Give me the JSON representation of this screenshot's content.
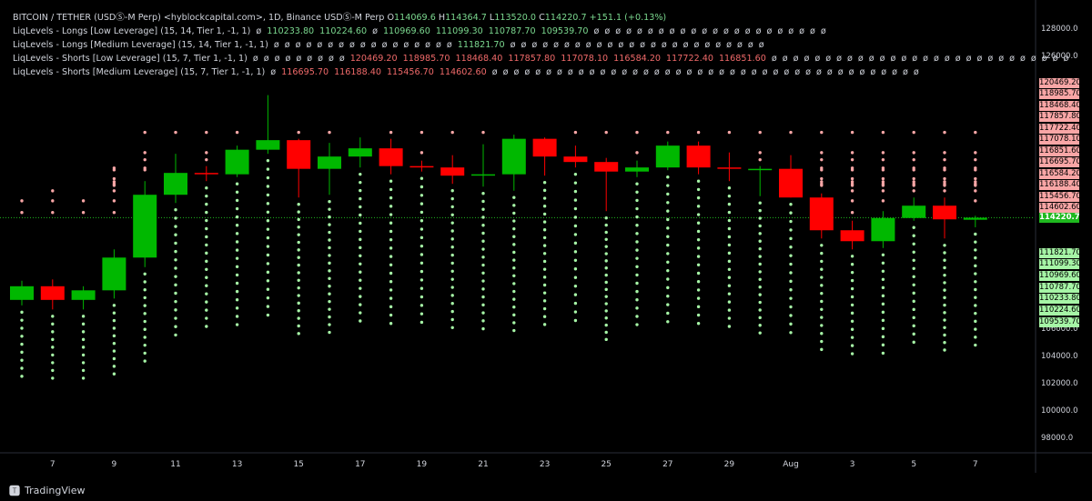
{
  "header": {
    "title": "BITCOIN / TETHER (USDⓈ-M Perp) <hyblockcapital.com>, 1D, Binance USDⓈ-M Perp",
    "ohlc": [
      {
        "label": "O",
        "value": "114069.6"
      },
      {
        "label": "H",
        "value": "114364.7"
      },
      {
        "label": "L",
        "value": "113520.0"
      },
      {
        "label": "C",
        "value": "114220.7"
      }
    ],
    "change": "+151.1 (+0.13%)"
  },
  "indicators": [
    {
      "name": "LiqLevels - Longs [Low Leverage] (15, 14, Tier 1, -1, 1)",
      "values": [
        "ø",
        "110233.80",
        "110224.60",
        "ø",
        "110969.60",
        "111099.30",
        "110787.70",
        "109539.70",
        "ø",
        "ø",
        "ø",
        "ø",
        "ø",
        "ø",
        "ø",
        "ø",
        "ø",
        "ø",
        "ø",
        "ø",
        "ø",
        "ø",
        "ø",
        "ø",
        "ø",
        "ø",
        "ø",
        "ø",
        "ø",
        "ø"
      ],
      "color": "#7bd88f"
    },
    {
      "name": "LiqLevels - Longs [Medium Leverage] (15, 14, Tier 1, -1, 1)",
      "values": [
        "ø",
        "ø",
        "ø",
        "ø",
        "ø",
        "ø",
        "ø",
        "ø",
        "ø",
        "ø",
        "ø",
        "ø",
        "ø",
        "ø",
        "ø",
        "ø",
        "ø",
        "111821.70",
        "ø",
        "ø",
        "ø",
        "ø",
        "ø",
        "ø",
        "ø",
        "ø",
        "ø",
        "ø",
        "ø",
        "ø",
        "ø",
        "ø",
        "ø",
        "ø",
        "ø",
        "ø",
        "ø",
        "ø",
        "ø",
        "ø",
        "ø",
        "ø"
      ],
      "color": "#7bd88f"
    },
    {
      "name": "LiqLevels - Shorts [Low Leverage] (15, 7, Tier 1, -1, 1)",
      "values": [
        "ø",
        "ø",
        "ø",
        "ø",
        "ø",
        "ø",
        "ø",
        "ø",
        "ø",
        "120469.20",
        "118985.70",
        "118468.40",
        "117857.80",
        "117078.10",
        "116584.20",
        "117722.40",
        "116851.60",
        "ø",
        "ø",
        "ø",
        "ø",
        "ø",
        "ø",
        "ø",
        "ø",
        "ø",
        "ø",
        "ø",
        "ø",
        "ø",
        "ø",
        "ø",
        "ø",
        "ø",
        "ø",
        "ø",
        "ø",
        "ø",
        "ø",
        "ø",
        "ø",
        "ø",
        "ø",
        "ø",
        "ø"
      ],
      "color": "#f06a6a"
    },
    {
      "name": "LiqLevels - Shorts [Medium Leverage] (15, 7, Tier 1, -1, 1)",
      "values": [
        "ø",
        "116695.70",
        "116188.40",
        "115456.70",
        "114602.60",
        "ø",
        "ø",
        "ø",
        "ø",
        "ø",
        "ø",
        "ø",
        "ø",
        "ø",
        "ø",
        "ø",
        "ø",
        "ø",
        "ø",
        "ø",
        "ø",
        "ø",
        "ø",
        "ø",
        "ø",
        "ø",
        "ø",
        "ø",
        "ø",
        "ø",
        "ø",
        "ø",
        "ø",
        "ø",
        "ø",
        "ø",
        "ø",
        "ø",
        "ø",
        "ø",
        "ø",
        "ø",
        "ø",
        "ø",
        "ø"
      ],
      "color": "#f06a6a"
    }
  ],
  "price_axis": {
    "ticks": [
      "128000.0",
      "126000.0",
      "106000.0",
      "104000.0",
      "102000.0",
      "100000.0",
      "98000.0"
    ],
    "short_levels": [
      "120469.20",
      "118985.70",
      "118468.40",
      "117857.80",
      "117722.40",
      "117078.10",
      "116851.60",
      "116695.70",
      "116584.20",
      "116188.40",
      "115456.70",
      "114602.60"
    ],
    "current": "114220.7",
    "long_levels": [
      "111821.70",
      "111099.30",
      "110969.60",
      "110787.70",
      "110233.80",
      "110224.60",
      "109539.70"
    ]
  },
  "time_axis": {
    "labels": [
      "7",
      "9",
      "11",
      "13",
      "15",
      "17",
      "19",
      "21",
      "23",
      "25",
      "27",
      "29",
      "Aug",
      "3",
      "5",
      "7"
    ]
  },
  "branding": {
    "name": "TradingView"
  },
  "colors": {
    "bull": "#00b800",
    "bear": "#ff0000",
    "short_dot": "#f9a6a6",
    "long_dot": "#a6f5a6",
    "current_line": "#1fb81f"
  },
  "chart_data": {
    "type": "candlestick",
    "ylim": [
      97000,
      129500
    ],
    "candles": [
      {
        "date": "Jul 6",
        "o": 108200,
        "h": 109600,
        "l": 107800,
        "c": 109200
      },
      {
        "date": "Jul 7",
        "o": 109200,
        "h": 109700,
        "l": 107500,
        "c": 108200
      },
      {
        "date": "Jul 8",
        "o": 108200,
        "h": 109200,
        "l": 107500,
        "c": 108900
      },
      {
        "date": "Jul 9",
        "o": 108900,
        "h": 111900,
        "l": 108300,
        "c": 111300
      },
      {
        "date": "Jul 10",
        "o": 111300,
        "h": 116900,
        "l": 110600,
        "c": 115900
      },
      {
        "date": "Jul 11",
        "o": 115900,
        "h": 118900,
        "l": 115300,
        "c": 117500
      },
      {
        "date": "Jul 12",
        "o": 117500,
        "h": 118000,
        "l": 116900,
        "c": 117400
      },
      {
        "date": "Jul 13",
        "o": 117400,
        "h": 119500,
        "l": 117200,
        "c": 119200
      },
      {
        "date": "Jul 14",
        "o": 119200,
        "h": 123200,
        "l": 118900,
        "c": 119900
      },
      {
        "date": "Jul 15",
        "o": 119900,
        "h": 120000,
        "l": 115700,
        "c": 117800
      },
      {
        "date": "Jul 16",
        "o": 117800,
        "h": 119700,
        "l": 115900,
        "c": 118700
      },
      {
        "date": "Jul 17",
        "o": 118700,
        "h": 120100,
        "l": 117900,
        "c": 119300
      },
      {
        "date": "Jul 18",
        "o": 119300,
        "h": 120000,
        "l": 117400,
        "c": 118000
      },
      {
        "date": "Jul 19",
        "o": 118000,
        "h": 118400,
        "l": 117600,
        "c": 117900
      },
      {
        "date": "Jul 20",
        "o": 117900,
        "h": 118800,
        "l": 116700,
        "c": 117300
      },
      {
        "date": "Jul 21",
        "o": 117300,
        "h": 119600,
        "l": 116500,
        "c": 117400
      },
      {
        "date": "Jul 22",
        "o": 117400,
        "h": 120300,
        "l": 116200,
        "c": 120000
      },
      {
        "date": "Jul 23",
        "o": 120000,
        "h": 120100,
        "l": 117300,
        "c": 118700
      },
      {
        "date": "Jul 24",
        "o": 118700,
        "h": 119500,
        "l": 117900,
        "c": 118300
      },
      {
        "date": "Jul 25",
        "o": 118300,
        "h": 118600,
        "l": 114700,
        "c": 117600
      },
      {
        "date": "Jul 26",
        "o": 117600,
        "h": 118400,
        "l": 117200,
        "c": 117900
      },
      {
        "date": "Jul 27",
        "o": 117900,
        "h": 119800,
        "l": 117700,
        "c": 119500
      },
      {
        "date": "Jul 28",
        "o": 119500,
        "h": 119800,
        "l": 117400,
        "c": 117900
      },
      {
        "date": "Jul 29",
        "o": 117900,
        "h": 119000,
        "l": 116900,
        "c": 117800
      },
      {
        "date": "Jul 30",
        "o": 117800,
        "h": 118000,
        "l": 115800,
        "c": 117800
      },
      {
        "date": "Jul 31",
        "o": 117800,
        "h": 118800,
        "l": 115700,
        "c": 115700
      },
      {
        "date": "Aug 1",
        "o": 115700,
        "h": 116000,
        "l": 112700,
        "c": 113300
      },
      {
        "date": "Aug 2",
        "o": 113300,
        "h": 114000,
        "l": 111900,
        "c": 112500
      },
      {
        "date": "Aug 3",
        "o": 112500,
        "h": 114700,
        "l": 112000,
        "c": 114200
      },
      {
        "date": "Aug 4",
        "o": 114200,
        "h": 115700,
        "l": 114000,
        "c": 115100
      },
      {
        "date": "Aug 5",
        "o": 115100,
        "h": 115700,
        "l": 112700,
        "c": 114100
      },
      {
        "date": "Aug 6",
        "o": 114069.6,
        "h": 114364.7,
        "l": 113520,
        "c": 114220.7
      }
    ],
    "current_price": 114220.7
  }
}
